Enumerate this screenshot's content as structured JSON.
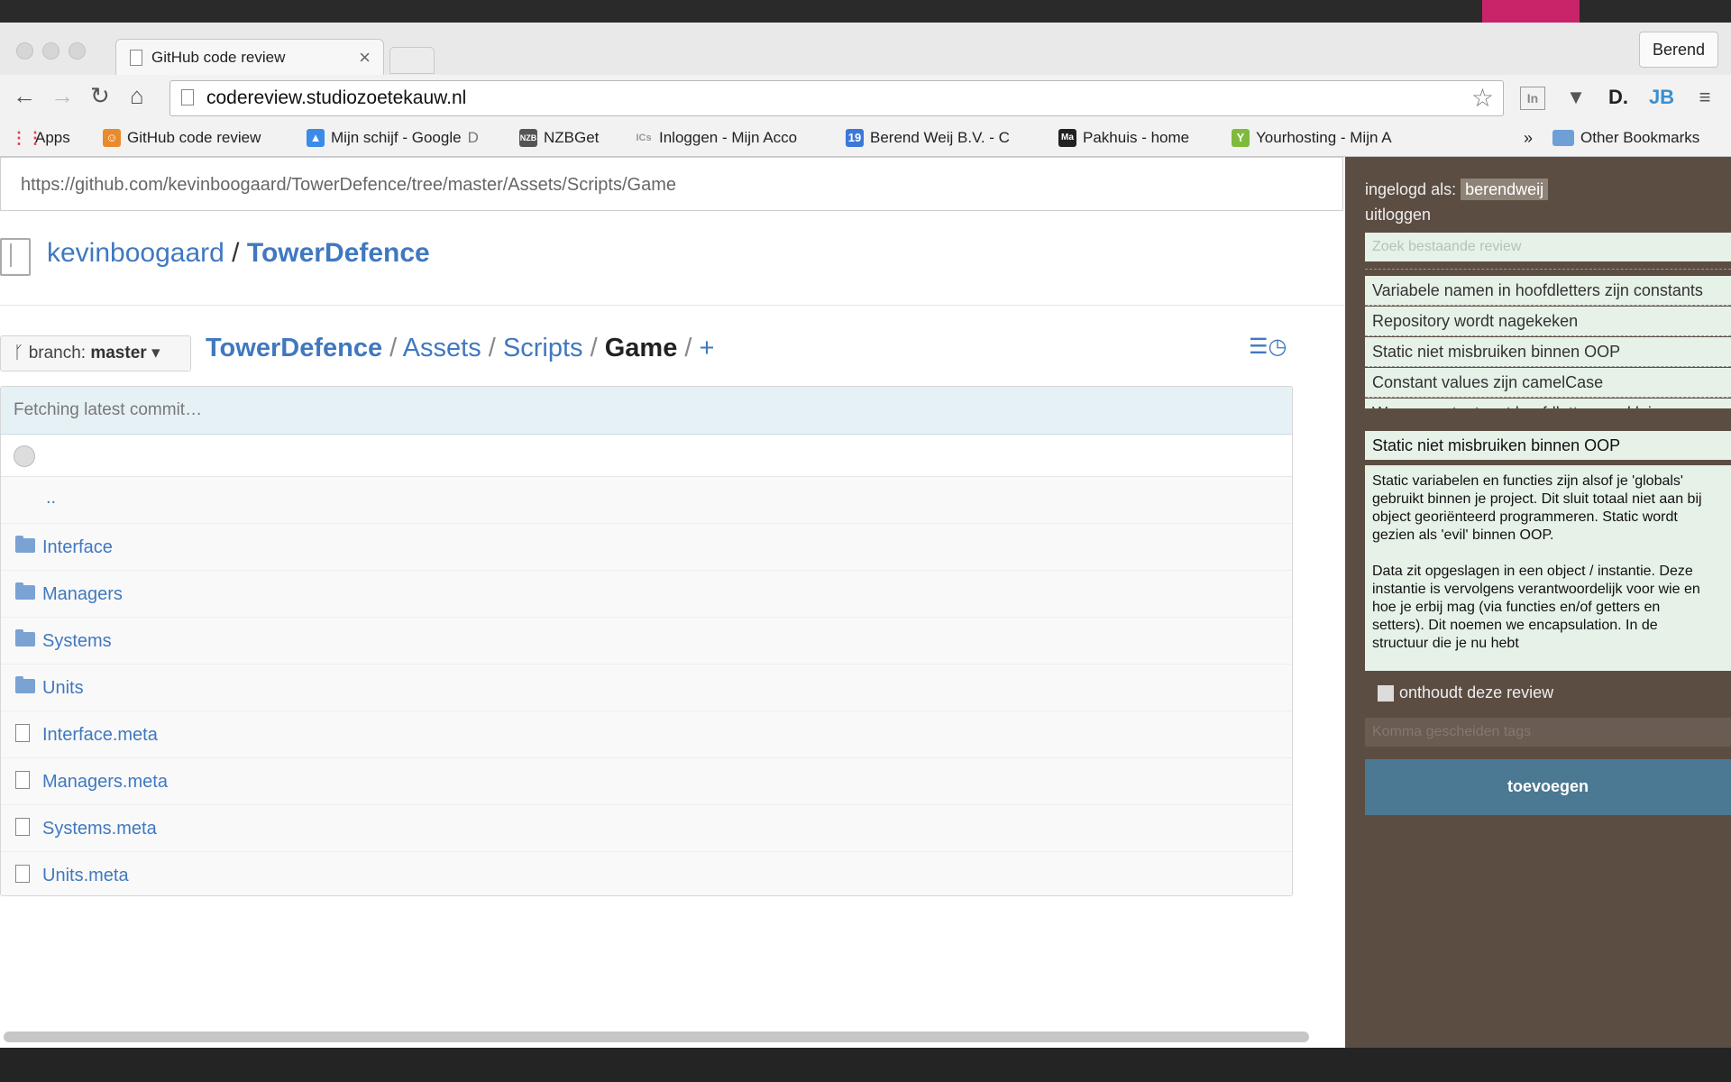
{
  "browser": {
    "tab_title": "GitHub code review",
    "tab_close": "×",
    "profile_name": "Berend",
    "url": "codereview.studiozoetekauw.nl",
    "bookmarks": [
      {
        "label": "Apps",
        "icon": "apps-grid-icon"
      },
      {
        "label": "GitHub code review",
        "icon": "codereview-favicon"
      },
      {
        "label": "Mijn schijf - Google",
        "fade": "D",
        "icon": "google-drive-icon"
      },
      {
        "label": "NZBGet",
        "icon": "nzbget-icon"
      },
      {
        "label": "Inloggen - Mijn Acco",
        "icon": "ics-icon"
      },
      {
        "label": "Berend Weij B.V. - C",
        "icon": "calendar-19-icon"
      },
      {
        "label": "Pakhuis - home",
        "icon": "pakhuis-icon"
      },
      {
        "label": "Yourhosting - Mijn A",
        "icon": "yourhosting-icon"
      }
    ],
    "bookmarks_overflow": "»",
    "other_bookmarks": "Other Bookmarks"
  },
  "github": {
    "source_url": "https://github.com/kevinboogaard/TowerDefence/tree/master/Assets/Scripts/Game",
    "owner": "kevinboogaard",
    "separator": "/",
    "repo": "TowerDefence",
    "branch_label": "branch:",
    "branch_name": "master",
    "breadcrumb": [
      "TowerDefence",
      "Assets",
      "Scripts"
    ],
    "current_dir": "Game",
    "add_file": "+",
    "commit_status": "Fetching latest commit…",
    "parent_dir": "..",
    "files": [
      {
        "name": "Interface",
        "type": "folder"
      },
      {
        "name": "Managers",
        "type": "folder"
      },
      {
        "name": "Systems",
        "type": "folder"
      },
      {
        "name": "Units",
        "type": "folder"
      },
      {
        "name": "Interface.meta",
        "type": "file"
      },
      {
        "name": "Managers.meta",
        "type": "file"
      },
      {
        "name": "Systems.meta",
        "type": "file"
      },
      {
        "name": "Units.meta",
        "type": "file"
      }
    ]
  },
  "sidebar": {
    "logged_in_label": "ingelogd als:",
    "username": "berendweij",
    "logout": "uitloggen",
    "search_placeholder": "Zoek bestaande review",
    "results": [
      "Variabele namen in hoofdletters zijn constants",
      "Repository wordt nagekeken",
      "Static niet misbruiken binnen OOP",
      "Constant values zijn camelCase",
      "Wees constant met hoofdletters en kleine"
    ],
    "review_title": "Static niet misbruiken binnen OOP",
    "review_body": [
      "Static variabelen en functies zijn alsof je 'globals' gebruikt binnen je project. Dit sluit totaal niet aan bij object georiënteerd programmeren. Static wordt gezien als 'evil' binnen OOP.",
      "Data zit opgeslagen in een object / instantie. Deze instantie is vervolgens verantwoordelijk voor wie en hoe je erbij mag (via functies en/of getters en setters). Dit noemen we encapsulation. In de structuur die je nu hebt"
    ],
    "remember_label": "onthoudt deze review",
    "tags_placeholder": "Komma gescheiden tags",
    "add_button": "toevoegen"
  },
  "colors": {
    "github_link": "#4078c0",
    "sidebar_bg": "#5c4d43",
    "sidebar_field": "#e6f1e7",
    "add_button": "#4b7892"
  }
}
